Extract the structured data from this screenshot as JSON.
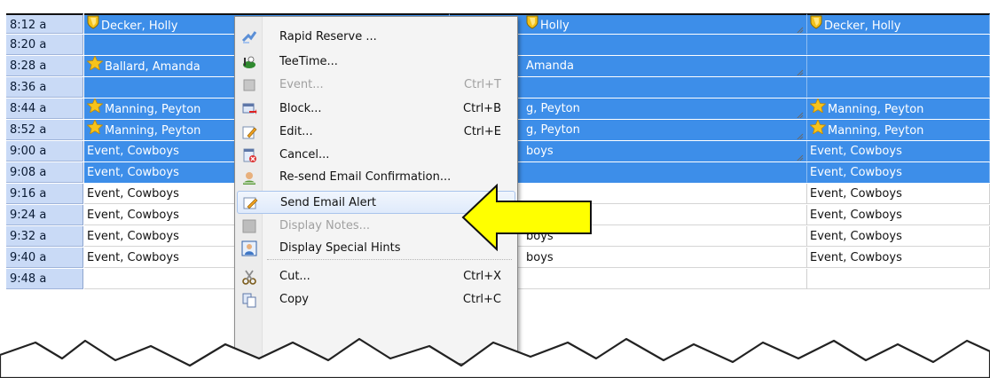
{
  "schedule": {
    "rows": [
      {
        "time": "8:12 a",
        "selected": true,
        "c1": {
          "icon": "shield-icon",
          "text": "Decker, Holly"
        },
        "c2": {
          "icon": "shield-icon",
          "text": "Holly"
        },
        "c3": {
          "icon": "shield-icon",
          "text": "Decker, Holly"
        }
      },
      {
        "time": "8:20 a",
        "selected": true,
        "c1": {
          "icon": "",
          "text": ""
        },
        "c2": {
          "icon": "",
          "text": ""
        },
        "c3": {
          "icon": "",
          "text": ""
        }
      },
      {
        "time": "8:28 a",
        "selected": true,
        "c1": {
          "icon": "star-icon",
          "text": "Ballard, Amanda"
        },
        "c2": {
          "icon": "",
          "text": "Amanda"
        },
        "c3": {
          "icon": "",
          "text": ""
        }
      },
      {
        "time": "8:36 a",
        "selected": true,
        "c1": {
          "icon": "",
          "text": ""
        },
        "c2": {
          "icon": "",
          "text": ""
        },
        "c3": {
          "icon": "",
          "text": ""
        }
      },
      {
        "time": "8:44 a",
        "selected": true,
        "c1": {
          "icon": "star-icon",
          "text": "Manning, Peyton"
        },
        "c2": {
          "icon": "",
          "text": "g, Peyton"
        },
        "c3": {
          "icon": "star-icon",
          "text": "Manning, Peyton"
        }
      },
      {
        "time": "8:52 a",
        "selected": true,
        "c1": {
          "icon": "star-icon",
          "text": "Manning, Peyton"
        },
        "c2": {
          "icon": "",
          "text": "g, Peyton"
        },
        "c3": {
          "icon": "star-icon",
          "text": "Manning, Peyton"
        }
      },
      {
        "time": "9:00 a",
        "selected": true,
        "c1": {
          "icon": "",
          "text": "Event, Cowboys"
        },
        "c2": {
          "icon": "",
          "text": "boys"
        },
        "c3": {
          "icon": "",
          "text": "Event, Cowboys"
        }
      },
      {
        "time": "9:08 a",
        "selected": true,
        "c1": {
          "icon": "",
          "text": "Event, Cowboys"
        },
        "c2": {
          "icon": "",
          "text": ""
        },
        "c3": {
          "icon": "",
          "text": "Event, Cowboys"
        }
      },
      {
        "time": "9:16 a",
        "selected": false,
        "c1": {
          "icon": "",
          "text": "Event, Cowboys"
        },
        "c2": {
          "icon": "",
          "text": ""
        },
        "c3": {
          "icon": "",
          "text": "Event, Cowboys"
        }
      },
      {
        "time": "9:24 a",
        "selected": false,
        "c1": {
          "icon": "",
          "text": "Event, Cowboys"
        },
        "c2": {
          "icon": "",
          "text": "boys"
        },
        "c3": {
          "icon": "",
          "text": "Event, Cowboys"
        }
      },
      {
        "time": "9:32 a",
        "selected": false,
        "c1": {
          "icon": "",
          "text": "Event, Cowboys"
        },
        "c2": {
          "icon": "",
          "text": "boys"
        },
        "c3": {
          "icon": "",
          "text": "Event, Cowboys"
        }
      },
      {
        "time": "9:40 a",
        "selected": false,
        "c1": {
          "icon": "",
          "text": "Event, Cowboys"
        },
        "c2": {
          "icon": "",
          "text": "boys"
        },
        "c3": {
          "icon": "",
          "text": "Event, Cowboys"
        }
      },
      {
        "time": "9:48 a",
        "selected": false,
        "c1": {
          "icon": "",
          "text": ""
        },
        "c2": {
          "icon": "",
          "text": ""
        },
        "c3": {
          "icon": "",
          "text": ""
        }
      }
    ]
  },
  "context_menu": {
    "items": [
      {
        "label": "Rapid Reserve ...",
        "shortcut": "",
        "icon": "rapid-reserve-icon",
        "disabled": false
      },
      {
        "label": "TeeTime...",
        "shortcut": "",
        "icon": "golf-tee-icon",
        "disabled": false
      },
      {
        "label": "Event...",
        "shortcut": "Ctrl+T",
        "icon": "event-icon",
        "disabled": true
      },
      {
        "label": "Block...",
        "shortcut": "Ctrl+B",
        "icon": "block-icon",
        "disabled": false
      },
      {
        "label": "Edit...",
        "shortcut": "Ctrl+E",
        "icon": "edit-icon",
        "disabled": false
      },
      {
        "label": "Cancel...",
        "shortcut": "",
        "icon": "cancel-icon",
        "disabled": false
      },
      {
        "label": "Re-send Email Confirmation...",
        "shortcut": "",
        "icon": "email-confirmation-icon",
        "disabled": false
      },
      {
        "label": "Send Email Alert",
        "shortcut": "",
        "icon": "email-alert-icon",
        "disabled": false,
        "highlighted": true
      },
      {
        "label": "Display Notes...",
        "shortcut": "",
        "icon": "notes-icon",
        "disabled": true
      },
      {
        "label": "Display Special Hints",
        "shortcut": "",
        "icon": "special-hints-icon",
        "disabled": false
      },
      {
        "label": "Cut...",
        "shortcut": "Ctrl+X",
        "icon": "cut-icon",
        "disabled": false
      },
      {
        "label": "Copy",
        "shortcut": "Ctrl+C",
        "icon": "copy-icon",
        "disabled": false
      }
    ]
  },
  "colors": {
    "selection": "#3d8ee9",
    "time_column": "#c9daf6",
    "arrow_fill": "#ffff00"
  }
}
